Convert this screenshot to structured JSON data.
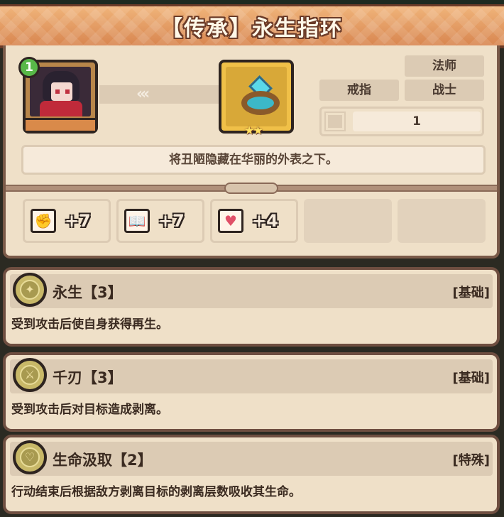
{
  "header": {
    "title": "【传承】永生指环"
  },
  "item": {
    "level": "1",
    "stars": "★★",
    "tags": {
      "class1": "法师",
      "type": "戒指",
      "class2": "战士"
    },
    "count": "1",
    "description": "将丑陋隐藏在华丽的外表之下。"
  },
  "stats": [
    {
      "icon": "fist-icon",
      "value": "+7"
    },
    {
      "icon": "book-icon",
      "value": "+7"
    },
    {
      "icon": "heart-icon",
      "value": "+4"
    }
  ],
  "skills": [
    {
      "name": "永生【3】",
      "tag": "[基础]",
      "desc": "受到攻击后使自身获得再生。"
    },
    {
      "name": "千刃【3】",
      "tag": "[基础]",
      "desc": "受到攻击后对目标造成剥离。"
    },
    {
      "name": "生命汲取【2】",
      "tag": "[特殊]",
      "desc": "行动结束后根据敌方剥离目标的剥离层数吸收其生命。"
    }
  ],
  "colors": {
    "banner": "#e09a62",
    "panel": "#efe0c8",
    "border": "#6e4e40"
  }
}
